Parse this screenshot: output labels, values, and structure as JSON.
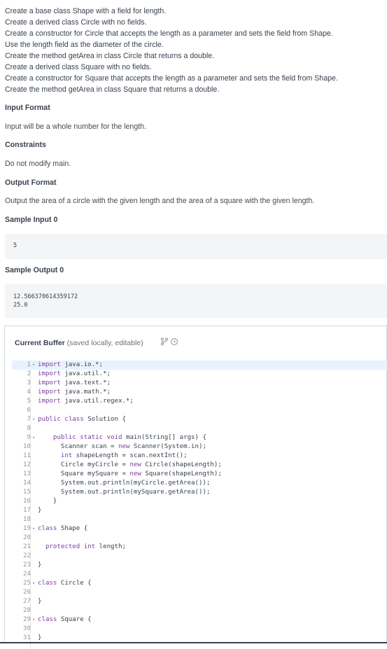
{
  "description": [
    "Create a base class Shape with a field for length.",
    "Create a derived class Circle with no fields.",
    "Create a constructor for Circle that accepts the length as a parameter and sets the field from Shape.",
    "Use the length field as the diameter of the circle.",
    "Create the method getArea in class Circle that returns a double.",
    "Create a derived class Square with no fields.",
    "Create a constructor for Square that accepts the length as a parameter and sets the field from Shape.",
    "Create the method getArea in class Square that returns a double."
  ],
  "sections": {
    "input_format_title": "Input Format",
    "input_format_text": "Input will be a whole number for the length.",
    "constraints_title": "Constraints",
    "constraints_text": "Do not modify main.",
    "output_format_title": "Output Format",
    "output_format_text": "Output the area of a circle with the given length and the area of a square with the given length.",
    "sample_input_title": "Sample Input 0",
    "sample_input": [
      "5"
    ],
    "sample_output_title": "Sample Output 0",
    "sample_output": [
      "12.566370614359172",
      "25.0"
    ]
  },
  "editor": {
    "buffer_title": "Current Buffer",
    "buffer_subtitle": "(saved locally, editable)",
    "icons": [
      "branch-icon",
      "history-icon"
    ],
    "lines": [
      {
        "n": "1",
        "fold": true,
        "text": "import java.io.*;"
      },
      {
        "n": "2",
        "fold": false,
        "text": "import java.util.*;"
      },
      {
        "n": "3",
        "fold": false,
        "text": "import java.text.*;"
      },
      {
        "n": "4",
        "fold": false,
        "text": "import java.math.*;"
      },
      {
        "n": "5",
        "fold": false,
        "text": "import java.util.regex.*;"
      },
      {
        "n": "6",
        "fold": false,
        "text": ""
      },
      {
        "n": "7",
        "fold": true,
        "text": "public class Solution {"
      },
      {
        "n": "8",
        "fold": false,
        "text": ""
      },
      {
        "n": "9",
        "fold": true,
        "text": "    public static void main(String[] args) {"
      },
      {
        "n": "10",
        "fold": false,
        "text": "      Scanner scan = new Scanner(System.in);"
      },
      {
        "n": "11",
        "fold": false,
        "text": "      int shapeLength = scan.nextInt();"
      },
      {
        "n": "12",
        "fold": false,
        "text": "      Circle myCircle = new Circle(shapeLength);"
      },
      {
        "n": "13",
        "fold": false,
        "text": "      Square mySquare = new Square(shapeLength);"
      },
      {
        "n": "14",
        "fold": false,
        "text": "      System.out.println(myCircle.getArea());"
      },
      {
        "n": "15",
        "fold": false,
        "text": "      System.out.println(mySquare.getArea());"
      },
      {
        "n": "16",
        "fold": false,
        "text": "    }"
      },
      {
        "n": "17",
        "fold": false,
        "text": "}"
      },
      {
        "n": "18",
        "fold": false,
        "text": ""
      },
      {
        "n": "19",
        "fold": true,
        "text": "class Shape {"
      },
      {
        "n": "20",
        "fold": false,
        "text": ""
      },
      {
        "n": "21",
        "fold": false,
        "text": "  protected int length;"
      },
      {
        "n": "22",
        "fold": false,
        "text": ""
      },
      {
        "n": "23",
        "fold": false,
        "text": "}"
      },
      {
        "n": "24",
        "fold": false,
        "text": ""
      },
      {
        "n": "25",
        "fold": true,
        "text": "class Circle {"
      },
      {
        "n": "26",
        "fold": false,
        "text": ""
      },
      {
        "n": "27",
        "fold": false,
        "text": "}"
      },
      {
        "n": "28",
        "fold": false,
        "text": ""
      },
      {
        "n": "29",
        "fold": true,
        "text": "class Square {"
      },
      {
        "n": "30",
        "fold": false,
        "text": ""
      },
      {
        "n": "31",
        "fold": false,
        "text": "}"
      }
    ],
    "active_line": 1
  }
}
